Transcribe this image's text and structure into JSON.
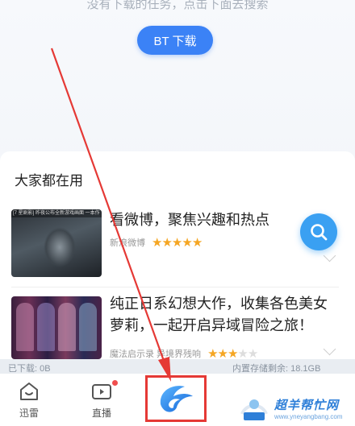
{
  "hint_text": "没有下载的任务，点击下面去搜索",
  "bt_button_label": "BT 下载",
  "section": {
    "title": "大家都在用",
    "items": [
      {
        "title": "看微博，聚焦兴趣和热点",
        "source": "新浪微博",
        "rating_stars": 5,
        "rating_max": 5,
        "thumb_caption": "[7 星剧影] 昨夜公布全新游戏画面 一本作"
      },
      {
        "title": "纯正日系幻想大作，收集各色美女萝莉，一起开启异域冒险之旅！",
        "source": "魔法启示录 异境界残响",
        "rating_stars": 3,
        "rating_max": 5
      }
    ]
  },
  "storage": {
    "downloaded": "已下载: 0B",
    "internal_free": "内置存储剩余: 18.1GB"
  },
  "tabs": [
    {
      "id": "xunlei",
      "label": "迅雷",
      "icon": "home-face-icon"
    },
    {
      "id": "live",
      "label": "直播",
      "icon": "video-camera-icon",
      "badge": true
    },
    {
      "id": "center",
      "label": "",
      "icon": "xunlei-bird-logo"
    }
  ],
  "watermark": {
    "text": "超羊帮忙网",
    "url": "www.yneyangbang.com"
  },
  "colors": {
    "accent": "#3b82f6",
    "star": "#f5a623",
    "highlight_box": "#e53935",
    "arrow": "#e53935"
  }
}
